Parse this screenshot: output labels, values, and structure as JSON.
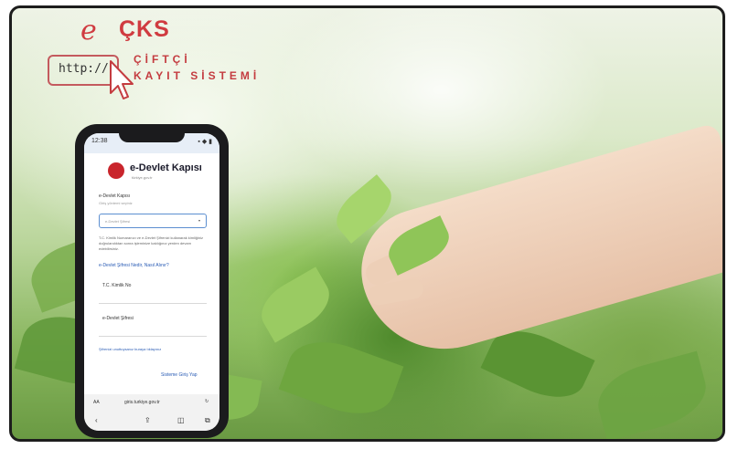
{
  "logo": {
    "mark": "e",
    "name": "ÇKS",
    "url_text": "http://",
    "subtitle_line1": "ÇİFTÇİ",
    "subtitle_line2": "KAYIT SİSTEMİ"
  },
  "phone": {
    "status_time": "12:38",
    "status_right": "▪ ◆ ▮",
    "header_title": "e-Devlet Kapısı",
    "header_subtitle": "türkiye.gov.tr",
    "login_heading": "e-Devlet Kapısı",
    "login_subheading": "Giriş yöntemi seçiniz",
    "select_value": "e-Devlet Şifresi",
    "info_text": "T.C. Kimlik Numaranızı ve e-Devlet Şifrenizi kullanarak kimliğiniz doğrulandıktan sonra işleminize kaldığınız yerden devam edebilirsiniz.",
    "info_link": "e-Devlet Şifresi Nedir, Nasıl Alınır?",
    "tc_label": "T.C. Kimlik No",
    "password_label": "e-Devlet Şifresi",
    "forgot_text": "Şifrenizi unuttuysanız buraya tıklayınız",
    "login_button": "Sisteme Giriş Yap",
    "url_aa": "AA",
    "url": "giris.turkiye.gov.tr",
    "nav_back": "‹",
    "nav_share": "⇪",
    "nav_book": "◫",
    "nav_tabs": "⧉"
  }
}
